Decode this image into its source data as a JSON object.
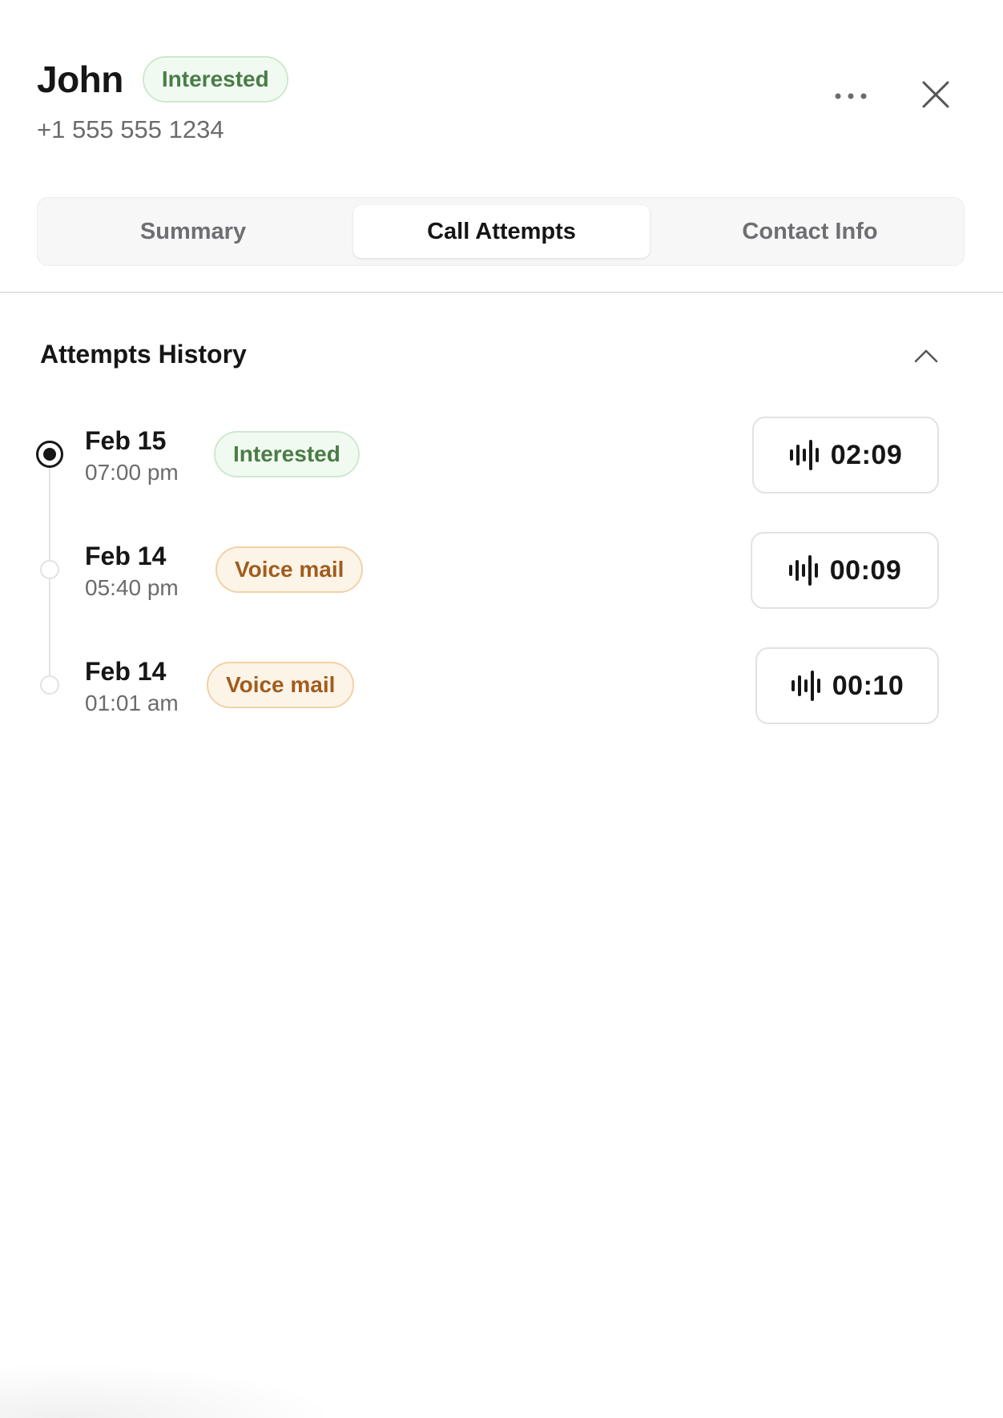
{
  "contact": {
    "name": "John",
    "status": "Interested",
    "phone": "+1 555 555 1234"
  },
  "actions": {
    "more_icon": "more-horizontal-icon",
    "close_icon": "close-icon"
  },
  "tabs": [
    {
      "label": "Summary",
      "active": false
    },
    {
      "label": "Call Attempts",
      "active": true
    },
    {
      "label": "Contact Info",
      "active": false
    }
  ],
  "history": {
    "title": "Attempts History",
    "collapse_icon": "chevron-up-icon",
    "attempts": [
      {
        "date": "Feb 15",
        "time": "07:00 pm",
        "status": "Interested",
        "duration": "02:09",
        "active": true
      },
      {
        "date": "Feb 14",
        "time": "05:40 pm",
        "status": "Voice mail",
        "duration": "00:09",
        "active": false
      },
      {
        "date": "Feb 14",
        "time": "01:01 am",
        "status": "Voice mail",
        "duration": "00:10",
        "active": false
      }
    ]
  },
  "colors": {
    "interested_text": "#4a7d47",
    "interested_bg": "#f1faf1",
    "voicemail_text": "#a05d1e",
    "voicemail_bg": "#fdf4e8"
  }
}
